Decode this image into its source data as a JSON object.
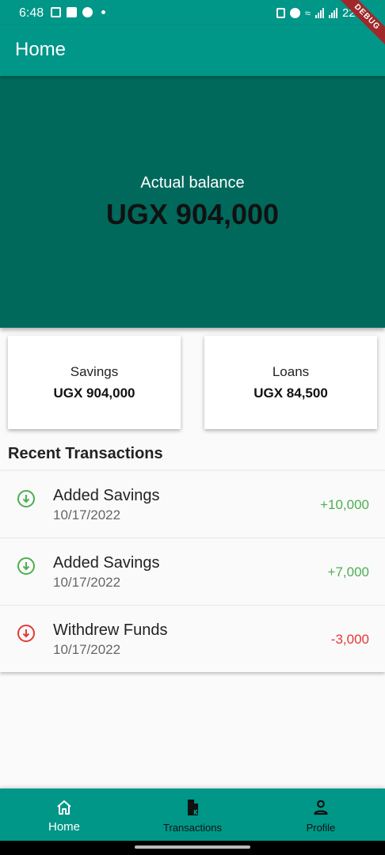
{
  "status_bar": {
    "time": "6:48",
    "battery": "22%"
  },
  "debug_banner": "DEBUG",
  "app_bar": {
    "title": "Home"
  },
  "balance": {
    "label": "Actual balance",
    "amount": "UGX 904,000"
  },
  "summary": {
    "savings": {
      "label": "Savings",
      "value": "UGX 904,000"
    },
    "loans": {
      "label": "Loans",
      "value": "UGX 84,500"
    }
  },
  "recent_transactions": {
    "title": "Recent Transactions",
    "items": [
      {
        "title": "Added Savings",
        "date": "10/17/2022",
        "amount": "+10,000",
        "type": "credit",
        "icon": "arrow-down-circle-icon"
      },
      {
        "title": "Added Savings",
        "date": "10/17/2022",
        "amount": "+7,000",
        "type": "credit",
        "icon": "arrow-down-circle-icon"
      },
      {
        "title": "Withdrew Funds",
        "date": "10/17/2022",
        "amount": "-3,000",
        "type": "debit",
        "icon": "arrow-down-circle-icon"
      }
    ]
  },
  "bottom_nav": {
    "items": [
      {
        "label": "Home",
        "icon": "home-icon",
        "active": true
      },
      {
        "label": "Transactions",
        "icon": "document-icon",
        "active": false
      },
      {
        "label": "Profile",
        "icon": "person-icon",
        "active": false
      }
    ]
  },
  "colors": {
    "primary": "#009688",
    "balance_bg": "#00695c",
    "credit": "#4caf50",
    "debit": "#e53935"
  }
}
